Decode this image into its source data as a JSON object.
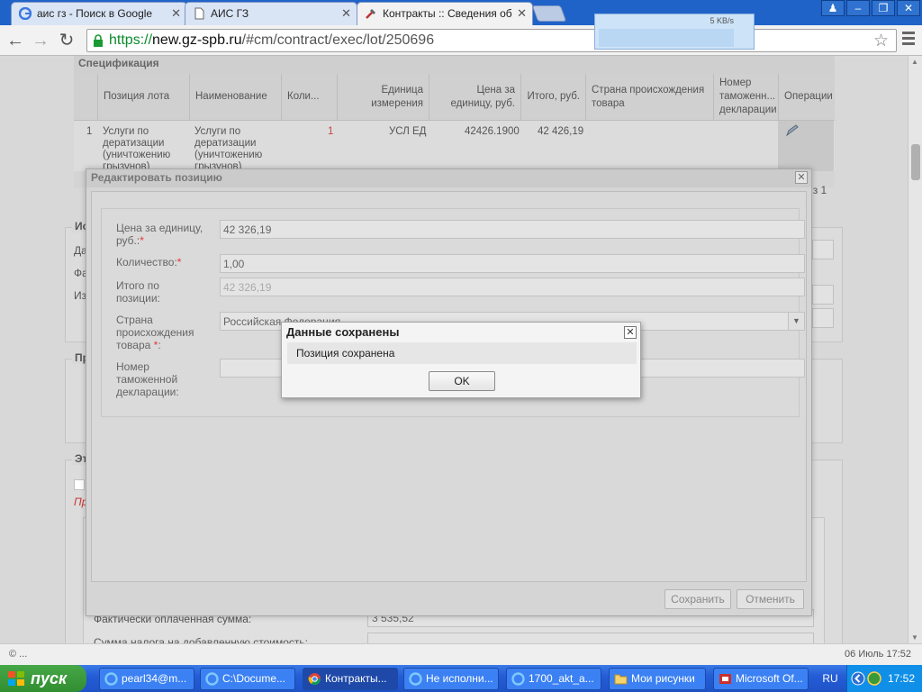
{
  "browser": {
    "tabs": [
      {
        "title": "аис гз - Поиск в Google",
        "icon": "google-icon"
      },
      {
        "title": "АИС ГЗ",
        "icon": "page-icon"
      },
      {
        "title": "Контракты :: Сведения об",
        "icon": "tools-icon"
      }
    ],
    "url_scheme": "https://",
    "url_host": "new.gz-spb.ru",
    "url_path": "/#cm/contract/exec/lot/250696",
    "net_rate": "5 KB/s"
  },
  "spec": {
    "title": "Спецификация",
    "columns": [
      "Позиция лота",
      "Наименование",
      "Коли...",
      "Единица измерения",
      "Цена за единицу, руб.",
      "Итого, руб.",
      "Страна происхождения товара",
      "Номер таможенн... декларации",
      "Операции"
    ],
    "row": {
      "num": "1",
      "position": "Услуги по дератизации (уничтожению грызунов)",
      "name": "Услуги по дератизации (уничтожению грызунов)",
      "qty": "1",
      "unit": "УСЛ ЕД",
      "price": "42426.1900",
      "total": "42 426,19"
    },
    "pager_tail": "из 1"
  },
  "background": {
    "side_labels": [
      "Да",
      "Фа",
      "Из"
    ],
    "legend_fragment_1": "Ис",
    "legend_fragment_2": "Пр",
    "legend_fragment_3": "Эт",
    "red_fragment": "Пр",
    "paid_label": "Фактически оплаченная сумма:",
    "paid_value": "3 535,52",
    "vat_label": "Сумма налога на добавленную стоимость:"
  },
  "edit_window": {
    "title": "Редактировать позицию",
    "fields": {
      "price_label": "Цена за единицу, руб.:",
      "price_value": "42 326,19",
      "qty_label": "Количество:",
      "qty_value": "1,00",
      "total_label": "Итого по позиции:",
      "total_value": "42 326,19",
      "country_label": "Страна происхождения товара",
      "country_value": "Российская Федерация",
      "customs_label": "Номер таможенной декларации:",
      "customs_value": ""
    },
    "save_label": "Сохранить",
    "cancel_label": "Отменить"
  },
  "alert": {
    "title": "Данные сохранены",
    "message": "Позиция сохранена",
    "ok_label": "OK"
  },
  "status": {
    "left": "© ...",
    "right": "06 Июль 17:52"
  },
  "taskbar": {
    "start_label": "пуск",
    "items": [
      {
        "label": "pearl34@m...",
        "icon": "ie-icon"
      },
      {
        "label": "C:\\Docume...",
        "icon": "ie-icon"
      },
      {
        "label": "Контракты...",
        "icon": "chrome-icon"
      },
      {
        "label": "Не исполни...",
        "icon": "ie-icon"
      },
      {
        "label": "1700_akt_a...",
        "icon": "ie-icon"
      },
      {
        "label": "Мои рисунки",
        "icon": "folder-icon"
      },
      {
        "label": "Microsoft Of...",
        "icon": "office-icon"
      }
    ],
    "lang": "RU",
    "clock": "17:52"
  }
}
